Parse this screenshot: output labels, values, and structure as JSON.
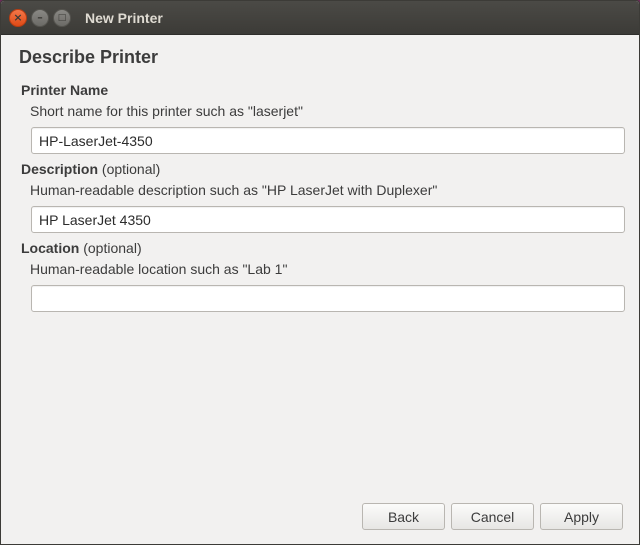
{
  "window": {
    "title": "New Printer",
    "controls": {
      "close": "×",
      "minimize": "–",
      "maximize": "□"
    }
  },
  "page": {
    "heading": "Describe Printer"
  },
  "printer_name": {
    "label": "Printer Name",
    "hint": "Short name for this printer such as \"laserjet\"",
    "value": "HP-LaserJet-4350"
  },
  "description": {
    "label": "Description",
    "optional": "(optional)",
    "hint": "Human-readable description such as \"HP LaserJet with Duplexer\"",
    "value": "HP LaserJet 4350"
  },
  "location": {
    "label": "Location",
    "optional": "(optional)",
    "hint": "Human-readable location such as \"Lab 1\"",
    "value": ""
  },
  "buttons": {
    "back": "Back",
    "cancel": "Cancel",
    "apply": "Apply"
  }
}
